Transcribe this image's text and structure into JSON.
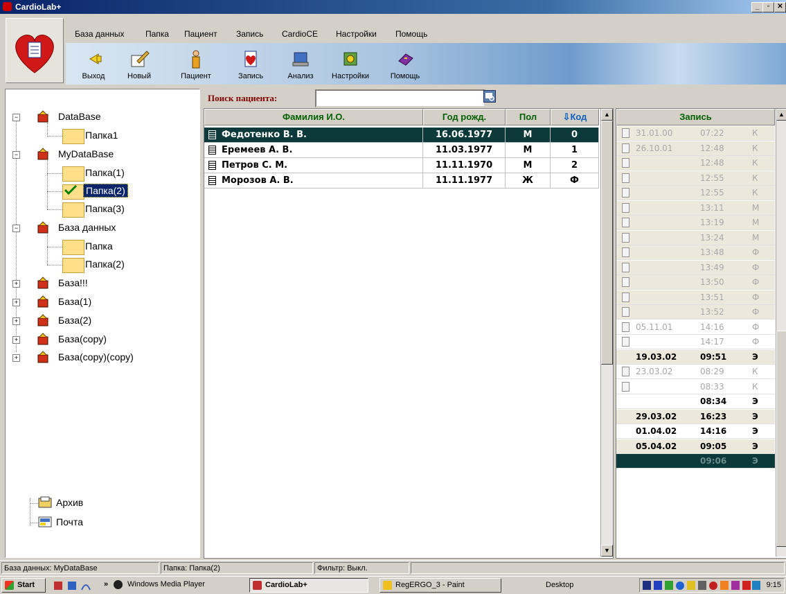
{
  "window": {
    "title": "CardioLab+",
    "controls": [
      "_",
      "▫",
      "✕"
    ]
  },
  "menu": [
    "База данных",
    "Папка",
    "Пациент",
    "Запись",
    "CardioCE",
    "Настройки",
    "Помощь"
  ],
  "toolbar": [
    {
      "label": "Выход",
      "icon": "exit-icon"
    },
    {
      "label": "Новый",
      "icon": "new-icon"
    },
    {
      "label": "Пациент",
      "icon": "patient-icon"
    },
    {
      "label": "Запись",
      "icon": "record-icon"
    },
    {
      "label": "Анализ",
      "icon": "analysis-icon"
    },
    {
      "label": "Настройки",
      "icon": "settings-icon"
    },
    {
      "label": "Помощь",
      "icon": "help-icon"
    }
  ],
  "tree": {
    "databases": [
      {
        "label": "DataBase",
        "expanded": true,
        "folders": [
          "Папка1"
        ]
      },
      {
        "label": "MyDataBase",
        "expanded": true,
        "folders": [
          "Папка(1)",
          "Папка(2)",
          "Папка(3)"
        ],
        "selected_folder": "Папка(2)"
      },
      {
        "label": "База данных",
        "expanded": true,
        "folders": [
          "Папка",
          "Папка(2)"
        ]
      },
      {
        "label": "База!!!",
        "expanded": false
      },
      {
        "label": "База(1)",
        "expanded": false
      },
      {
        "label": "База(2)",
        "expanded": false
      },
      {
        "label": "База(copy)",
        "expanded": false
      },
      {
        "label": "База(copy)(copy)",
        "expanded": false
      }
    ],
    "extra": [
      "Архив",
      "Почта"
    ]
  },
  "search": {
    "label": "Поиск пациента:",
    "value": ""
  },
  "patients": {
    "columns": [
      "Фамилия И.О.",
      "Год рожд.",
      "Пол",
      "Код"
    ],
    "sort_indicator": "⇩",
    "rows": [
      {
        "name": "Федотенко  В. В.",
        "dob": "16.06.1977",
        "sex": "М",
        "code": "0",
        "selected": true
      },
      {
        "name": "Еремеев  А. В.",
        "dob": "11.03.1977",
        "sex": "М",
        "code": "1"
      },
      {
        "name": "Петров  С. М.",
        "dob": "11.11.1970",
        "sex": "М",
        "code": "2"
      },
      {
        "name": "Морозов  А. В.",
        "dob": "11.11.1977",
        "sex": "Ж",
        "code": "Ф"
      }
    ]
  },
  "records": {
    "header": "Запись",
    "rows": [
      {
        "date": "31.01.00",
        "time": "07:22",
        "type": "К",
        "style": "dim"
      },
      {
        "date": "26.10.01",
        "time": "12:48",
        "type": "К",
        "style": "dim"
      },
      {
        "date": "",
        "time": "12:48",
        "type": "К",
        "style": "dim"
      },
      {
        "date": "",
        "time": "12:55",
        "type": "К",
        "style": "dim"
      },
      {
        "date": "",
        "time": "12:55",
        "type": "К",
        "style": "dim"
      },
      {
        "date": "",
        "time": "13:11",
        "type": "М",
        "style": "dim"
      },
      {
        "date": "",
        "time": "13:19",
        "type": "М",
        "style": "dim"
      },
      {
        "date": "",
        "time": "13:24",
        "type": "М",
        "style": "dim"
      },
      {
        "date": "",
        "time": "13:48",
        "type": "Ф",
        "style": "dim"
      },
      {
        "date": "",
        "time": "13:49",
        "type": "Ф",
        "style": "dim"
      },
      {
        "date": "",
        "time": "13:50",
        "type": "Ф",
        "style": "dim"
      },
      {
        "date": "",
        "time": "13:51",
        "type": "Ф",
        "style": "dim"
      },
      {
        "date": "",
        "time": "13:52",
        "type": "Ф",
        "style": "dim"
      },
      {
        "date": "05.11.01",
        "time": "14:16",
        "type": "Ф",
        "style": "dimw"
      },
      {
        "date": "",
        "time": "14:17",
        "type": "Ф",
        "style": "dimw"
      },
      {
        "date": "19.03.02",
        "time": "09:51",
        "type": "Э",
        "style": "boldt"
      },
      {
        "date": "23.03.02",
        "time": "08:29",
        "type": "К",
        "style": "dimw"
      },
      {
        "date": "",
        "time": "08:33",
        "type": "К",
        "style": "dimw"
      },
      {
        "date": "",
        "time": "08:34",
        "type": "Э",
        "style": "bold"
      },
      {
        "date": "29.03.02",
        "time": "16:23",
        "type": "Э",
        "style": "boldt"
      },
      {
        "date": "01.04.02",
        "time": "14:16",
        "type": "Э",
        "style": "bold"
      },
      {
        "date": "05.04.02",
        "time": "09:05",
        "type": "Э",
        "style": "boldt"
      },
      {
        "date": "",
        "time": "09:06",
        "type": "Э",
        "style": "sel"
      }
    ]
  },
  "status": [
    "База данных: MyDataBase",
    "Папка: Папка(2)",
    "Фильтр: Выкл."
  ],
  "taskbar": {
    "start": "Start",
    "items": [
      "Windows Media Player",
      "CardioLab+",
      "RegERGO_3 - Paint"
    ],
    "desktop": "Desktop",
    "clock": "9:15"
  },
  "colors": {
    "accent": "#0c3a3a",
    "header_text": "#006000",
    "search_label": "#800000"
  }
}
